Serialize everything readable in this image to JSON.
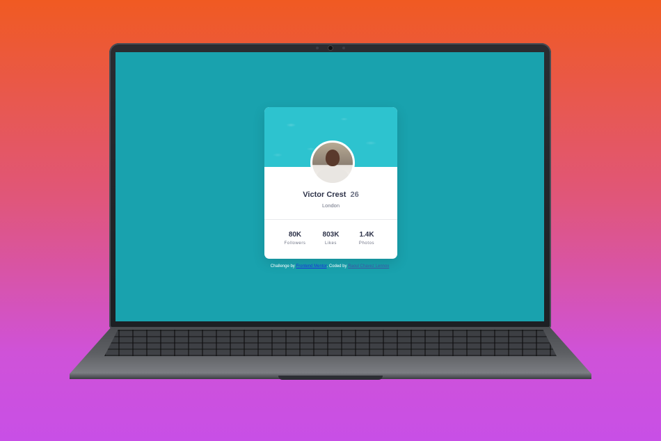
{
  "profile": {
    "name": "Victor Crest",
    "age": "26",
    "location": "London"
  },
  "stats": [
    {
      "value": "80K",
      "label": "Followers"
    },
    {
      "value": "803K",
      "label": "Likes"
    },
    {
      "value": "1.4K",
      "label": "Photos"
    }
  ],
  "attribution": {
    "prefix": "Challenge by ",
    "link1": "Frontend Mentor",
    "middle": ". Coded by ",
    "link2": "Raoul Chavez Lennox"
  },
  "colors": {
    "screen_bg": "#19a2ae",
    "card_header": "#2dc3cf",
    "text_dark": "#2e3349",
    "text_muted": "#6b7082"
  }
}
